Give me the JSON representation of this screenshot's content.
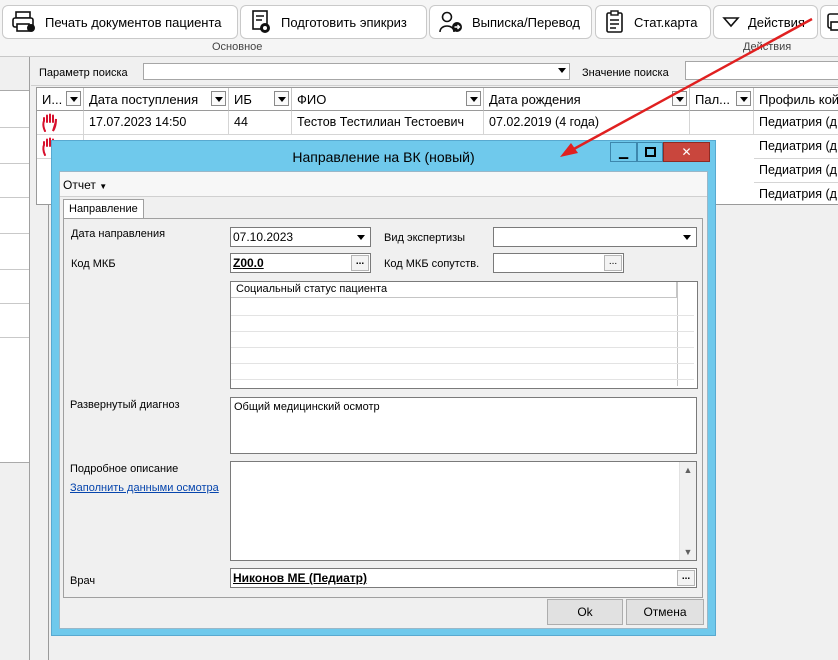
{
  "ribbon": {
    "buttons": [
      {
        "label": "Печать документов пациента",
        "icon": "printer-icon"
      },
      {
        "label": "Подготовить эпикриз",
        "icon": "document-gear-icon"
      },
      {
        "label": "Выписка/Перевод",
        "icon": "person-arrow-icon"
      },
      {
        "label": "Стат.карта",
        "icon": "clipboard-icon"
      },
      {
        "label": "Действия",
        "icon": "chevron-down-icon"
      }
    ],
    "group_main": "Основное",
    "group_actions": "Действия"
  },
  "filter": {
    "param_label": "Параметр поиска",
    "param_value": "",
    "value_label": "Значение поиска",
    "value_value": ""
  },
  "grid": {
    "columns": [
      "И...",
      "Дата поступления",
      "ИБ",
      "ФИО",
      "Дата рождения",
      "Пал...",
      "Профиль кой"
    ],
    "rows": [
      [
        "",
        "17.07.2023 14:50",
        "44",
        "Тестов Тестилиан Тестоевич",
        "07.02.2019 (4 года)",
        "",
        "Педиатрия (д"
      ],
      [
        "",
        "",
        "",
        "",
        "",
        "",
        "Педиатрия (д"
      ],
      [
        "",
        "",
        "",
        "",
        "",
        "",
        "Педиатрия (д"
      ],
      [
        "",
        "",
        "",
        "",
        "",
        "",
        "Педиатрия (д"
      ]
    ]
  },
  "dialog": {
    "title": "Направление на ВК (новый)",
    "menu_report": "Отчет",
    "tab_direction": "Направление",
    "direction_date_label": "Дата направления",
    "direction_date": "07.10.2023",
    "expertise_label": "Вид экспертизы",
    "expertise_value": "",
    "mkb_label": "Код МКБ",
    "mkb_value": "Z00.0",
    "mkb_side_label": "Код МКБ сопутств.",
    "mkb_side_value": "",
    "social_status_header": "Социальный статус пациента",
    "diagnosis_label": "Развернутый диагноз",
    "diagnosis_value": "Общий медицинский осмотр",
    "description_label": "Подробное описание",
    "fill_link": "Заполнить данными осмотра",
    "description_value": "",
    "doctor_label": "Врач",
    "doctor_value": "Никонов МЕ (Педиатр)",
    "ok_label": "Ok",
    "cancel_label": "Отмена",
    "ellipsis": "...",
    "scroll_up": "▲",
    "scroll_down": "▼",
    "minimize": "▁",
    "close": "✕"
  },
  "colors": {
    "dialog_frame": "#6fc9ec",
    "close_button": "#c9463d",
    "arrow": "#e02020",
    "alert_icon": "#d8102d"
  }
}
